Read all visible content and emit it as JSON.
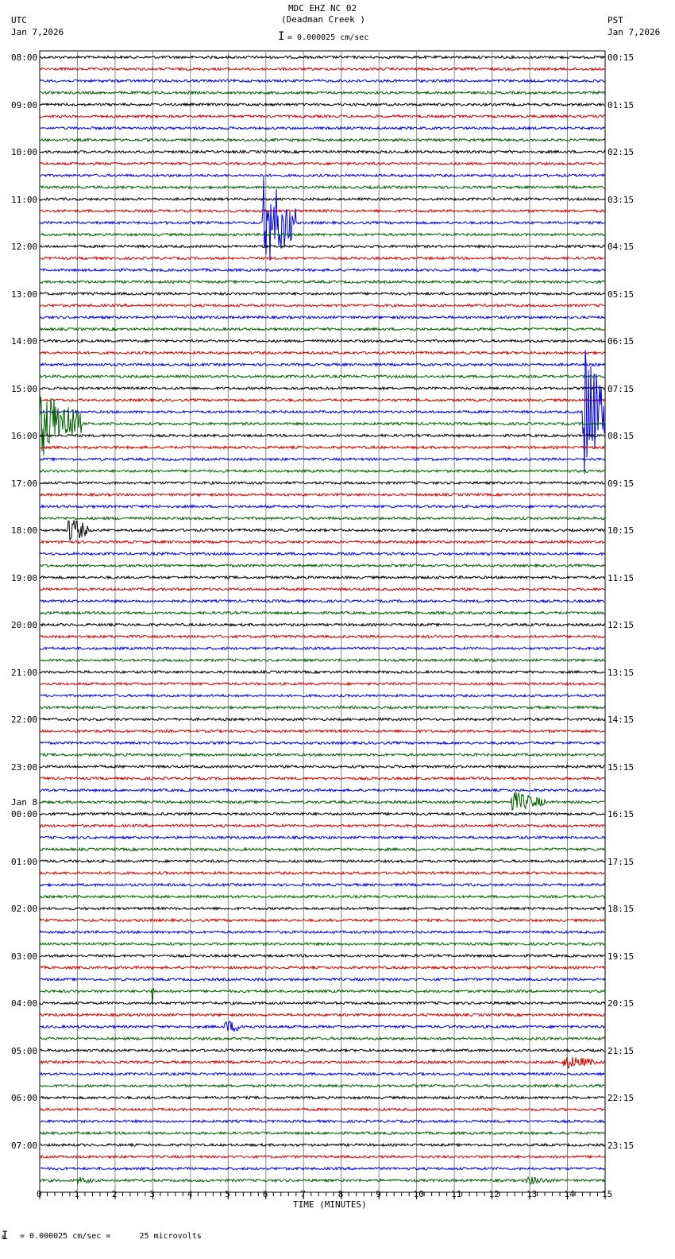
{
  "header": {
    "title": "MDC EHZ NC 02",
    "subtitle": "(Deadman Creek )",
    "left_tz": "UTC",
    "left_date": "Jan 7,2026",
    "right_tz": "PST",
    "right_date": "Jan 7,2026",
    "scale": "= 0.000025 cm/sec"
  },
  "footer": {
    "scale": "= 0.000025 cm/sec =      25 microvolts",
    "marker": "A"
  },
  "chart_data": {
    "type": "line",
    "title": "MDC EHZ NC 02 (Deadman Creek )",
    "xlabel": "TIME (MINUTES)",
    "xlim": [
      0,
      15
    ],
    "x_ticks": [
      "0",
      "1",
      "2",
      "3",
      "4",
      "5",
      "6",
      "7",
      "8",
      "9",
      "10",
      "11",
      "12",
      "13",
      "14",
      "15"
    ],
    "traces_per_hour": 4,
    "trace_count": 96,
    "colors": [
      "#000000",
      "#d00000",
      "#0000e0",
      "#006000"
    ],
    "left_labels": [
      "08:00",
      "09:00",
      "10:00",
      "11:00",
      "12:00",
      "13:00",
      "14:00",
      "15:00",
      "16:00",
      "17:00",
      "18:00",
      "19:00",
      "20:00",
      "21:00",
      "22:00",
      "23:00",
      "00:00",
      "01:00",
      "02:00",
      "03:00",
      "04:00",
      "05:00",
      "06:00",
      "07:00"
    ],
    "date_change": {
      "hour_index": 16,
      "label": "Jan 8"
    },
    "right_labels": [
      "00:15",
      "01:15",
      "02:15",
      "03:15",
      "04:15",
      "05:15",
      "06:15",
      "07:15",
      "08:15",
      "09:15",
      "10:15",
      "11:15",
      "12:15",
      "13:15",
      "14:15",
      "15:15",
      "16:15",
      "17:15",
      "18:15",
      "19:15",
      "20:15",
      "21:15",
      "22:15",
      "23:15"
    ],
    "events": [
      {
        "trace": 14,
        "start": 5.9,
        "end": 6.8,
        "amp": 60
      },
      {
        "trace": 30,
        "start": 14.4,
        "end": 15,
        "amp": 95
      },
      {
        "trace": 31,
        "start": 0,
        "end": 1.1,
        "amp": 45
      },
      {
        "trace": 40,
        "start": 0.75,
        "end": 1.3,
        "amp": 18
      },
      {
        "trace": 63,
        "start": 12.5,
        "end": 13.4,
        "amp": 14
      },
      {
        "trace": 79,
        "start": 2.95,
        "end": 3.05,
        "amp": 28
      },
      {
        "trace": 82,
        "start": 4.9,
        "end": 5.5,
        "amp": 9
      },
      {
        "trace": 85,
        "start": 13.9,
        "end": 14.8,
        "amp": 9
      },
      {
        "trace": 95,
        "start": 12.9,
        "end": 13.6,
        "amp": 6
      },
      {
        "trace": 95,
        "start": 1.0,
        "end": 1.5,
        "amp": 5
      }
    ]
  }
}
